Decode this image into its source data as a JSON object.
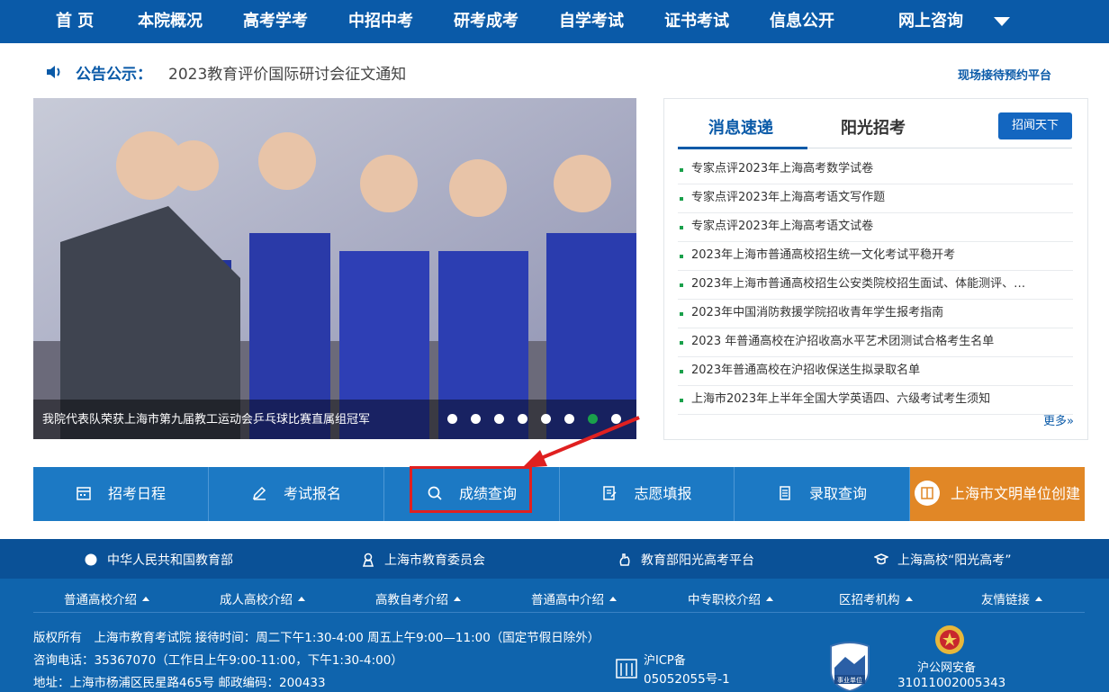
{
  "nav": {
    "items": [
      "首 页",
      "本院概况",
      "高考学考",
      "中招中考",
      "研考成考",
      "自学考试",
      "证书考试",
      "信息公开",
      "网上咨询"
    ]
  },
  "notice": {
    "label": "公告公示：",
    "text": "2023教育评价国际研讨会征文通知"
  },
  "booking": {
    "label": "现场接待预约平台"
  },
  "slider": {
    "caption": "我院代表队荣获上海市第九届教工运动会乒乓球比赛直属组冠军",
    "dots": 8,
    "active_dot": 6
  },
  "news": {
    "tabs": [
      "消息速递",
      "阳光招考"
    ],
    "tag_button": "招闻天下",
    "items": [
      "专家点评2023年上海高考数学试卷",
      "专家点评2023年上海高考语文写作题",
      "专家点评2023年上海高考语文试卷",
      "2023年上海市普通高校招生统一文化考试平稳开考",
      "2023年上海市普通高校招生公安类院校招生面试、体能测评、…",
      "2023年中国消防救援学院招收青年学生报考指南",
      "2023 年普通高校在沪招收高水平艺术团测试合格考生名单",
      "2023年普通高校在沪招收保送生拟录取名单",
      "上海市2023年上半年全国大学英语四、六级考试考生须知"
    ],
    "more": "更多»"
  },
  "quicklinks": [
    "招考日程",
    "考试报名",
    "成绩查询",
    "志愿填报",
    "录取查询",
    "上海市文明单位创建"
  ],
  "footer": {
    "links": [
      "中华人民共和国教育部",
      "上海市教育委员会",
      "教育部阳光高考平台",
      "上海高校“阳光高考”"
    ],
    "sublinks": [
      "普通高校介绍",
      "成人高校介绍",
      "高教自考介绍",
      "普通高中介绍",
      "中专职校介绍",
      "区招考机构",
      "友情链接"
    ],
    "info": [
      "版权所有　上海市教育考试院 接待时间：周二下午1:30-4:00 周五上午9:00—11:00（国定节假日除外）",
      "咨询电话：35367070（工作日上午9:00-11:00，下午1:30-4:00）",
      "地址：上海市杨浦区民星路465号 邮政编码：200433"
    ],
    "icp_label": "沪ICP备",
    "icp_number": "05052055号-1",
    "badge_text": "事业单位",
    "police_label": "沪公网安备",
    "police_number": "31011002005343"
  },
  "colors": {
    "primary": "#0a5aa8",
    "button": "#1c79c4",
    "orange": "#e18726",
    "highlight": "#e02020",
    "active_dot": "#1aa04b"
  }
}
